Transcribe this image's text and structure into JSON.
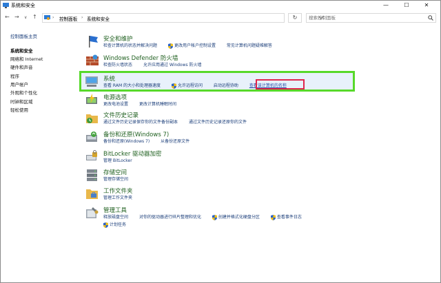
{
  "window": {
    "title": "系统和安全"
  },
  "address": {
    "crumbs": [
      "控制面板",
      "系统和安全"
    ],
    "search_placeholder": "搜索控制面板"
  },
  "sidebar": {
    "items": [
      {
        "label": "控制面板主页",
        "type": "link"
      },
      {
        "label": "系统和安全",
        "type": "active"
      },
      {
        "label": "网络和 Internet",
        "type": "plain"
      },
      {
        "label": "硬件和声音",
        "type": "plain"
      },
      {
        "label": "程序",
        "type": "plain"
      },
      {
        "label": "用户帐户",
        "type": "plain"
      },
      {
        "label": "外观和个性化",
        "type": "plain"
      },
      {
        "label": "时钟和区域",
        "type": "plain"
      },
      {
        "label": "轻松使用",
        "type": "plain"
      }
    ]
  },
  "categories": [
    {
      "title": "安全和维护",
      "icon": "flag-icon",
      "links": [
        {
          "t": "检查计算机的状态并解决问题"
        },
        {
          "t": "更改用户帐户控制设置",
          "shield": true
        },
        {
          "t": "常见计算机问题疑难解答"
        }
      ]
    },
    {
      "title": "Windows Defender 防火墙",
      "icon": "firewall-icon",
      "links": [
        {
          "t": "检查防火墙状态"
        },
        {
          "t": "允许应用通过 Windows 防火墙"
        }
      ]
    },
    {
      "title": "系统",
      "icon": "computer-icon",
      "links": [
        {
          "t": "查看 RAM 的大小和处理器速度"
        },
        {
          "t": "允许远程访问",
          "shield": true
        },
        {
          "t": "启动远程协助"
        },
        {
          "t": "查看该计算机的名称"
        }
      ]
    },
    {
      "title": "电源选项",
      "icon": "power-icon",
      "links": [
        {
          "t": "更改电池设置"
        },
        {
          "t": "更改计算机睡眠时间"
        }
      ]
    },
    {
      "title": "文件历史记录",
      "icon": "file-history-icon",
      "links": [
        {
          "t": "通过文件历史记录保存你的文件备份副本"
        },
        {
          "t": "通过文件历史记录还原你的文件"
        }
      ]
    },
    {
      "title": "备份和还原(Windows 7)",
      "icon": "backup-icon",
      "links": [
        {
          "t": "备份和还原(Windows 7)"
        },
        {
          "t": "从备份还原文件"
        }
      ]
    },
    {
      "title": "BitLocker 驱动器加密",
      "icon": "bitlocker-icon",
      "links": [
        {
          "t": "管理 BitLocker"
        }
      ]
    },
    {
      "title": "存储空间",
      "icon": "storage-icon",
      "links": [
        {
          "t": "管理存储空间"
        }
      ]
    },
    {
      "title": "工作文件夹",
      "icon": "work-folders-icon",
      "links": [
        {
          "t": "管理工作文件夹"
        }
      ]
    },
    {
      "title": "管理工具",
      "icon": "admin-tools-icon",
      "links": [
        {
          "t": "释放磁盘空间"
        },
        {
          "t": "对你的驱动器进行碎片整理和优化"
        },
        {
          "t": "创建并格式化硬盘分区",
          "shield": true
        },
        {
          "t": "查看事件日志",
          "shield": true
        }
      ],
      "links2": [
        {
          "t": "计划任务",
          "shield": true
        }
      ]
    }
  ],
  "colors": {
    "highlight_green": "#57d92a",
    "highlight_red": "#e0254b",
    "category_title": "#1e5f1e",
    "link": "#1b3e7a"
  }
}
